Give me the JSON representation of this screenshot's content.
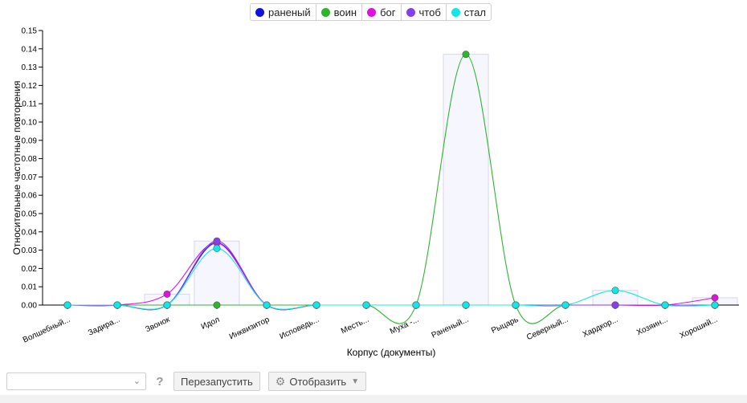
{
  "chart_data": {
    "type": "line",
    "xlabel": "Корпус (документы)",
    "ylabel": "Относительные частотные повторения",
    "ylim": [
      0,
      0.15
    ],
    "yticks": [
      "0.00",
      "0.01",
      "0.02",
      "0.03",
      "0.04",
      "0.05",
      "0.06",
      "0.07",
      "0.08",
      "0.09",
      "0.10",
      "0.11",
      "0.12",
      "0.13",
      "0.14",
      "0.15"
    ],
    "categories": [
      "Волшебный...",
      "Задира...",
      "Звонок",
      "Идол",
      "Инквизитор",
      "Исповедь...",
      "Месть...",
      "Муха -...",
      "Раненый...",
      "Рыцарь",
      "Северный...",
      "Хардкор...",
      "Хозяин...",
      "Хороший..."
    ],
    "series": [
      {
        "name": "раненый",
        "color": "#1010e0",
        "values": [
          0,
          0,
          0,
          0.034,
          0,
          0,
          0,
          0,
          0,
          0,
          0,
          0,
          0,
          0
        ]
      },
      {
        "name": "воин",
        "color": "#2db52d",
        "values": [
          0,
          0,
          0,
          0,
          0,
          0,
          0,
          0,
          0.137,
          0,
          0,
          0,
          0,
          0
        ]
      },
      {
        "name": "бог",
        "color": "#e010e0",
        "values": [
          0,
          0,
          0.006,
          0.034,
          0,
          0,
          0,
          0,
          0,
          0,
          0,
          0,
          0,
          0.004
        ]
      },
      {
        "name": "чтоб",
        "color": "#8a3cf0",
        "values": [
          0,
          0,
          0,
          0.035,
          0,
          0,
          0,
          0,
          0,
          0,
          0,
          0,
          0,
          0
        ]
      },
      {
        "name": "стал",
        "color": "#10e8e8",
        "values": [
          0,
          0,
          0,
          0.031,
          0,
          0,
          0,
          0,
          0,
          0,
          0,
          0.008,
          0,
          0
        ]
      }
    ],
    "legend_position": "top-center"
  },
  "toolbar": {
    "select_value": "",
    "help_label": "?",
    "restart_label": "Перезапустить",
    "display_label": "Отобразить"
  }
}
